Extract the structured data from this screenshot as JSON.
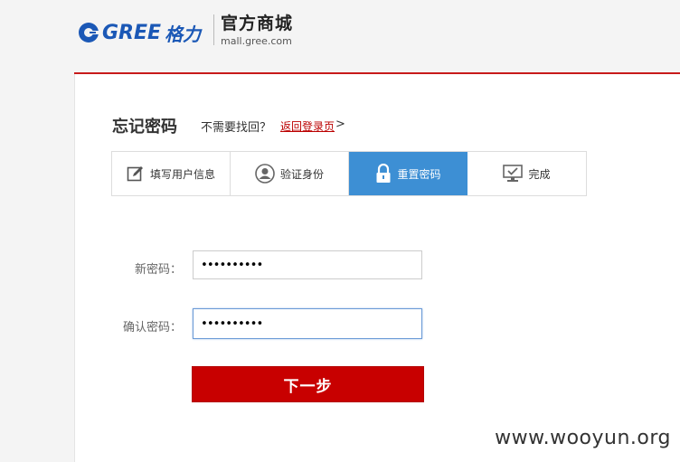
{
  "header": {
    "logo_text": "GREE",
    "logo_script": "格力",
    "store_title": "官方商城",
    "store_url": "mall.gree.com"
  },
  "colors": {
    "brand_red": "#c80000",
    "active_blue": "#3d8fd4",
    "logo_blue": "#1b58b6"
  },
  "page": {
    "title": "忘记密码",
    "hint": "不需要找回？",
    "back_link": "返回登录页",
    "back_arrow": ">"
  },
  "steps": [
    {
      "label": "填写用户信息",
      "icon": "edit-icon",
      "active": false
    },
    {
      "label": "验证身份",
      "icon": "user-icon",
      "active": false
    },
    {
      "label": "重置密码",
      "icon": "lock-icon",
      "active": true
    },
    {
      "label": "完成",
      "icon": "monitor-check-icon",
      "active": false
    }
  ],
  "form": {
    "new_password_label": "新密码：",
    "new_password_value": "••••••••••",
    "confirm_password_label": "确认密码：",
    "confirm_password_value": "••••••••••",
    "submit_label": "下一步"
  },
  "watermark": "www.wooyun.org"
}
